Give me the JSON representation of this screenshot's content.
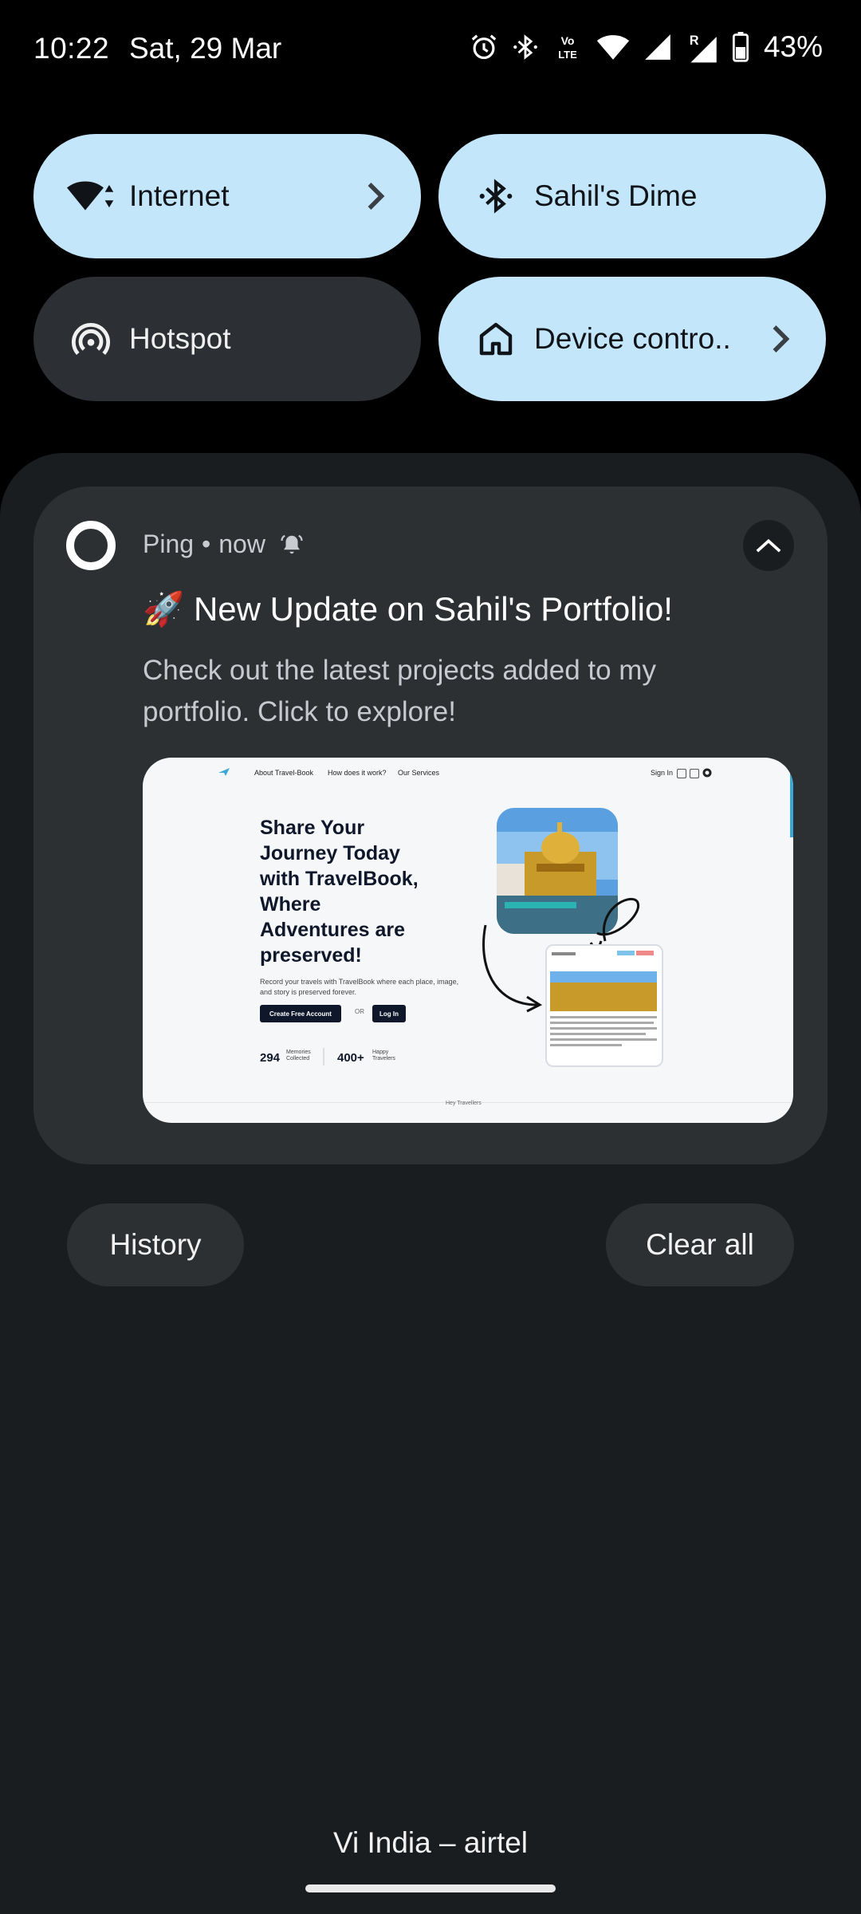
{
  "status_bar": {
    "time": "10:22",
    "date": "Sat, 29 Mar",
    "icons": [
      "alarm-icon",
      "bluetooth-icon",
      "volte-icon",
      "wifi-icon",
      "signal-icon",
      "signal-roaming-icon",
      "battery-icon"
    ],
    "volte_text": "Vo LTE",
    "roaming_mark": "R",
    "battery": "43%"
  },
  "quick_settings": [
    {
      "label": "Internet",
      "icon": "wifi-icon",
      "active": true,
      "has_chevron": true
    },
    {
      "label": "Sahil's Dime",
      "icon": "bluetooth-icon",
      "active": true,
      "has_chevron": false
    },
    {
      "label": "Hotspot",
      "icon": "hotspot-icon",
      "active": false,
      "has_chevron": false
    },
    {
      "label": "Device contro..",
      "icon": "home-icon",
      "active": true,
      "has_chevron": true
    }
  ],
  "notification": {
    "app_name": "Ping",
    "separator": "•",
    "time": "now",
    "title": "🚀 New Update on Sahil's Portfolio!",
    "body": "Check out the latest projects added to my portfolio. Click to explore!",
    "preview": {
      "nav_links": [
        "About Travel-Book",
        "How does it work?",
        "Our Services"
      ],
      "sign_in": "Sign In",
      "heading_lines": [
        "Share Your",
        "Journey Today",
        "with TravelBook,",
        "Where",
        "Adventures are",
        "preserved!"
      ],
      "subtext": "Record your travels with TravelBook where each place, image, and story is preserved forever.",
      "primary_button": "Create Free Account",
      "or_text": "OR",
      "secondary_button": "Log In",
      "stats": [
        {
          "value": "294",
          "label": "Memories Collected"
        },
        {
          "value": "400+",
          "label": "Happy Travelers"
        }
      ],
      "footer": "Hey Travellers"
    }
  },
  "actions": {
    "history": "History",
    "clear_all": "Clear all"
  },
  "carrier": "Vi India – airtel",
  "colors": {
    "tile_active": "#c3e6fb",
    "tile_inactive": "#2c3034",
    "shade": "#1a1d20",
    "notification_card": "#2c3033"
  }
}
